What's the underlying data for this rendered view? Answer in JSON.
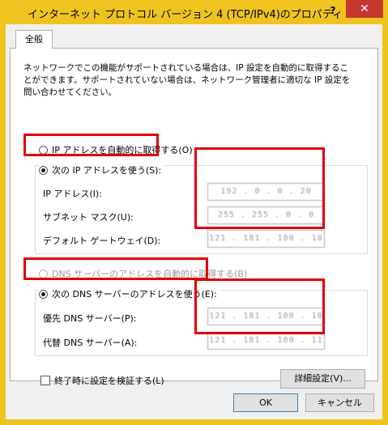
{
  "window": {
    "title": "インターネット プロトコル バージョン 4 (TCP/IPv4)のプロパティ",
    "help_label": "?",
    "close_label": "✕"
  },
  "tab": {
    "label": "全般"
  },
  "description": "ネットワークでこの機能がサポートされている場合は、IP 設定を自動的に取得することができます。サポートされていない場合は、ネットワーク管理者に適切な IP 設定を問い合わせてください。",
  "ip_section": {
    "auto_label": "IP アドレスを自動的に取得する(O)",
    "manual_label": "次の IP アドレスを使う(S):",
    "selected": "manual",
    "fields": [
      {
        "label": "IP アドレス(I):",
        "value": "192 . 0 . 0 . 20"
      },
      {
        "label": "サブネット マスク(U):",
        "value": "255 . 255 . 0 . 0"
      },
      {
        "label": "デフォルト ゲートウェイ(D):",
        "value": "121 . 181 . 100 . 10"
      }
    ]
  },
  "dns_section": {
    "auto_label": "DNS サーバーのアドレスを自動的に取得する(B)",
    "manual_label": "次の DNS サーバーのアドレスを使う(E):",
    "selected": "manual",
    "fields": [
      {
        "label": "優先 DNS サーバー(P):",
        "value": "121 . 181 . 100 . 10"
      },
      {
        "label": "代替 DNS サーバー(A):",
        "value": "121 . 181 . 100 . 11"
      }
    ]
  },
  "validate_label": "終了時に設定を検証する(L)",
  "advanced_label": "詳細設定(V)...",
  "ok_label": "OK",
  "cancel_label": "キャンセル",
  "colors": {
    "frame": "#f0c420",
    "highlight": "#e00000",
    "close": "#c7372f"
  }
}
